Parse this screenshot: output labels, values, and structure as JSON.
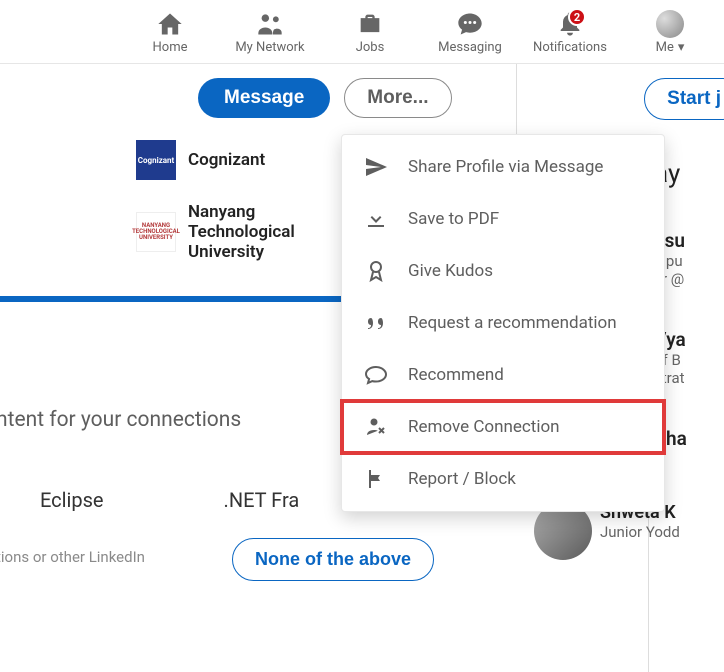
{
  "nav": {
    "home": "Home",
    "network": "My Network",
    "jobs": "Jobs",
    "messaging": "Messaging",
    "notifications": "Notifications",
    "notifications_count": "2",
    "me": "Me"
  },
  "actions": {
    "message": "Message",
    "more": "More...",
    "start": "Start j"
  },
  "entities": [
    {
      "logo": "Cognizant",
      "name": "Cognizant"
    },
    {
      "logo": "NTU",
      "name": "Nanyang Technological University"
    }
  ],
  "menu": {
    "share": "Share Profile via Message",
    "pdf": "Save to PDF",
    "kudos": "Give Kudos",
    "request_rec": "Request a recommendation",
    "recommend": "Recommend",
    "remove": "Remove Connection",
    "report": "Report / Block"
  },
  "content_prompt": "ntent for your connections",
  "skills": {
    "a": "Eclipse",
    "b": ".NET Fra"
  },
  "bottom_hint": "tions or other LinkedIn",
  "none_btn": "None of the above",
  "right": {
    "heading": "ay",
    "p1_name": "usu",
    "p1_sub1": "hipu",
    "p1_sub2": "er @",
    "p2_name": "Vya",
    "p2_sub1": " of B",
    "p2_sub2": "strat",
    "p3_name": " Bha",
    "p3_name_full": "Shweta K",
    "p3_sub": "Junior Yodd"
  }
}
